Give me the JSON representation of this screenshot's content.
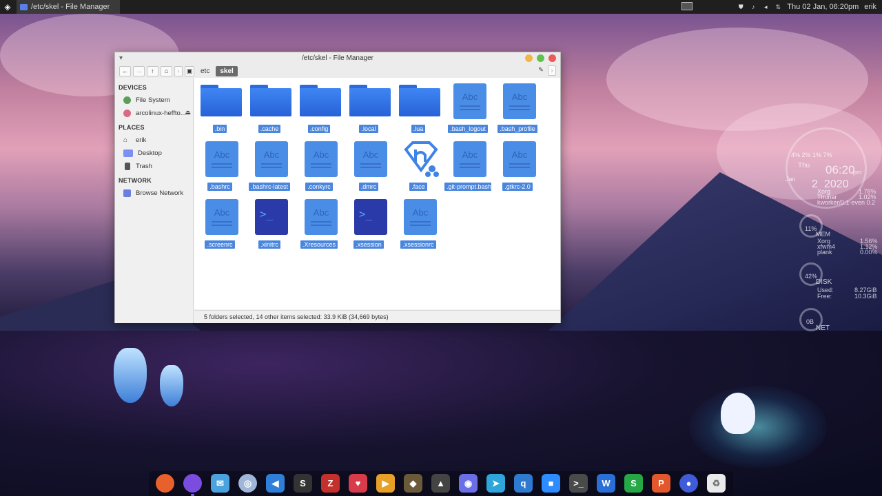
{
  "top_panel": {
    "task_title": "/etc/skel - File Manager",
    "clock": "Thu 02 Jan, 06:20pm",
    "user": "erik"
  },
  "window": {
    "title": "/etc/skel - File Manager",
    "breadcrumbs": [
      {
        "label": "etc"
      },
      {
        "label": "skel"
      }
    ]
  },
  "sidebar": {
    "devices_header": "DEVICES",
    "devices": [
      {
        "label": "File System",
        "icon": "drive-icon"
      },
      {
        "label": "arcolinux-heffto...",
        "icon": "disc-icon"
      }
    ],
    "places_header": "PLACES",
    "places": [
      {
        "label": "erik",
        "icon": "home-icon"
      },
      {
        "label": "Desktop",
        "icon": "desktop-icon"
      },
      {
        "label": "Trash",
        "icon": "trash-icon"
      }
    ],
    "network_header": "NETWORK",
    "network": [
      {
        "label": "Browse Network",
        "icon": "network-icon"
      }
    ]
  },
  "files": [
    {
      "name": ".bin",
      "kind": "folder"
    },
    {
      "name": ".cache",
      "kind": "folder"
    },
    {
      "name": ".config",
      "kind": "folder"
    },
    {
      "name": ".local",
      "kind": "folder"
    },
    {
      "name": ".lua",
      "kind": "folder"
    },
    {
      "name": ".bash_logout",
      "kind": "text"
    },
    {
      "name": ".bash_profile",
      "kind": "text"
    },
    {
      "name": ".bashrc",
      "kind": "text"
    },
    {
      "name": ".bashrc-latest",
      "kind": "text"
    },
    {
      "name": ".conkyrc",
      "kind": "text"
    },
    {
      "name": ".dmrc",
      "kind": "text"
    },
    {
      "name": ".face",
      "kind": "image"
    },
    {
      "name": ".git-prompt.bash",
      "kind": "text"
    },
    {
      "name": ".gtkrc-2.0",
      "kind": "text"
    },
    {
      "name": ".screenrc",
      "kind": "text"
    },
    {
      "name": ".xinitrc",
      "kind": "script"
    },
    {
      "name": ".Xresources",
      "kind": "text"
    },
    {
      "name": ".xsession",
      "kind": "script"
    },
    {
      "name": ".xsessionrc",
      "kind": "text"
    }
  ],
  "doc_icon_text": "Abc",
  "term_icon_text": ">_",
  "status_text": "5 folders selected, 14 other items selected: 33.9 KiB (34,669 bytes)",
  "conky": {
    "cpu_line": "4% 2% 1% 7%",
    "day": "Thu",
    "time": "06:20",
    "pm": "pm",
    "date": "2",
    "year": "2020",
    "month": "Jan",
    "top1_name": "Xorg",
    "top1_val": "1.78%",
    "top2_name": "Thunar",
    "top2_val": "1.02%",
    "top3": "kworker/0:1-even  0.2",
    "mem_pct": "11%",
    "mem_label": "MEM",
    "m1_name": "Xorg",
    "m1_val": "1.56%",
    "m2_name": "xfwm4",
    "m2_val": "1.12%",
    "m3_name": "plank",
    "m3_val": "0.00%",
    "disk_pct": "42%",
    "disk_label": "DISK",
    "used_label": "Used:",
    "used_val": "8.27GiB",
    "free_label": "Free:",
    "free_val": "10.3GiB",
    "net_pct": "0B",
    "net_label": "NET"
  },
  "dock": [
    {
      "name": "firefox-icon",
      "glyph": "",
      "color": "#e8602c"
    },
    {
      "name": "purple-app-icon",
      "glyph": "",
      "color": "#7a4de0"
    },
    {
      "name": "mail-icon",
      "glyph": "✉",
      "color": "#4aa3df"
    },
    {
      "name": "compass-icon",
      "glyph": "◎",
      "color": "#9fb6d8"
    },
    {
      "name": "vscode-icon",
      "glyph": "◀",
      "color": "#2f7fd8"
    },
    {
      "name": "s-app-icon",
      "glyph": "S",
      "color": "#333333"
    },
    {
      "name": "filezilla-icon",
      "glyph": "Z",
      "color": "#c4302b"
    },
    {
      "name": "strawberry-icon",
      "glyph": "♥",
      "color": "#d83b4a"
    },
    {
      "name": "media-player-icon",
      "glyph": "▶",
      "color": "#e6a126"
    },
    {
      "name": "gimp-icon",
      "glyph": "◆",
      "color": "#6b5a3a"
    },
    {
      "name": "inkscape-icon",
      "glyph": "▲",
      "color": "#444444"
    },
    {
      "name": "discord-icon",
      "glyph": "◉",
      "color": "#6a6fe8"
    },
    {
      "name": "telegram-icon",
      "glyph": "➤",
      "color": "#2ea6dc"
    },
    {
      "name": "qbittorrent-icon",
      "glyph": "q",
      "color": "#2e7ad1"
    },
    {
      "name": "zoom-icon",
      "glyph": "■",
      "color": "#2d8cff"
    },
    {
      "name": "terminal-icon",
      "glyph": ">_",
      "color": "#4a4a4a"
    },
    {
      "name": "writer-icon",
      "glyph": "W",
      "color": "#2a6fd6"
    },
    {
      "name": "spreadsheet-icon",
      "glyph": "S",
      "color": "#25a745"
    },
    {
      "name": "presentation-icon",
      "glyph": "P",
      "color": "#e2572b"
    },
    {
      "name": "toggle-app-icon",
      "glyph": "●",
      "color": "#3f5bd8"
    },
    {
      "name": "recycle-icon",
      "glyph": "♻",
      "color": "#eaeaea"
    }
  ]
}
